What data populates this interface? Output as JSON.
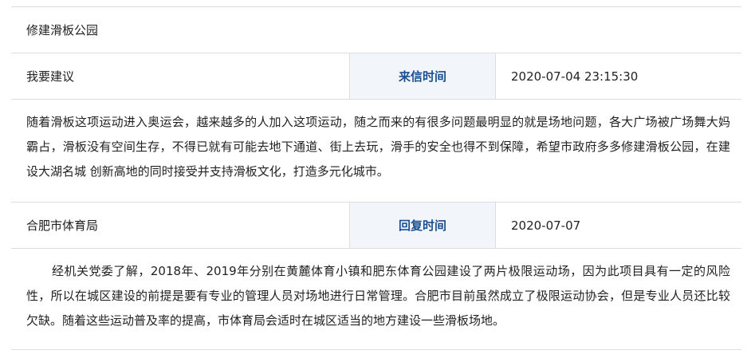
{
  "subject": {
    "title": "修建滑板公园"
  },
  "letter": {
    "category": "我要建议",
    "time_label": "来信时间",
    "time_value": "2020-07-04 23:15:30",
    "content": "随着滑板这项运动进入奥运会，越来越多的人加入这项运动，随之而来的有很多问题最明显的就是场地问题，各大广场被广场舞大妈霸占，滑板没有空间生存，不得已就有可能去地下通道、街上去玩，滑手的安全也得不到保障，希望市政府多多修建滑板公园，在建设大湖名城 创新高地的同时接受并支持滑板文化，打造多元化城市。"
  },
  "reply": {
    "department": "合肥市体育局",
    "time_label": "回复时间",
    "time_value": "2020-07-07",
    "content": "经机关党委了解，2018年、2019年分别在黄麓体育小镇和肥东体育公园建设了两片极限运动场，因为此项目具有一定的风险性，所以在城区建设的前提是要有专业的管理人员对场地进行日常管理。合肥市目前虽然成立了极限运动协会，但是专业人员还比较欠缺。随着这些运动普及率的提高，市体育局会适时在城区适当的地方建设一些滑板场地。"
  }
}
